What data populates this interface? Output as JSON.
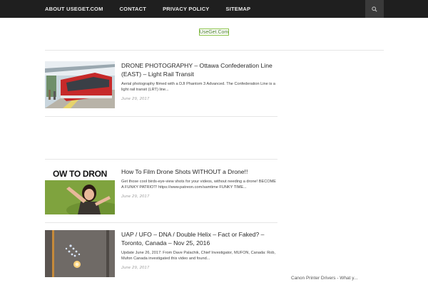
{
  "nav": {
    "items": [
      {
        "label": "ABOUT USEGET.COM"
      },
      {
        "label": "CONTACT"
      },
      {
        "label": "PRIVACY POLICY"
      },
      {
        "label": "SITEMAP"
      }
    ],
    "search_icon": "search-icon"
  },
  "logo": {
    "text": "UseGet.Com"
  },
  "posts": [
    {
      "title": "DRONE PHOTOGRAPHY – Ottawa Confederation Line (EAST) – Light Rail Transit",
      "excerpt": "Aerial photography filmed with a DJI Phantom 3 Advanced. The Confederation Line is a light rail transit (LRT) line...",
      "date": "June 29, 2017"
    },
    {
      "title": "How To Film Drone Shots WITHOUT a Drone!!",
      "excerpt": "Get those cool birds-eye-view shots for your videos, without needing a drone! BECOME A FUNKY PATRIOT! https://www.patreon.com/samtime FUNKY TIME...",
      "date": "June 29, 2017",
      "thumb_text": "OW TO DRON"
    },
    {
      "title": "UAP / UFO – DNA / Double Helix – Fact or Faked? – Toronto, Canada – Nov 25, 2016",
      "excerpt": "Update June 26, 2017: From Dave Palachik, Chief Investigator, MUFON, Canada: Rob, Mufon Canada investigated this video and found...",
      "date": "June 29, 2017"
    }
  ],
  "sidebar": {
    "link": "Canon Printer Drivers - What y..."
  }
}
